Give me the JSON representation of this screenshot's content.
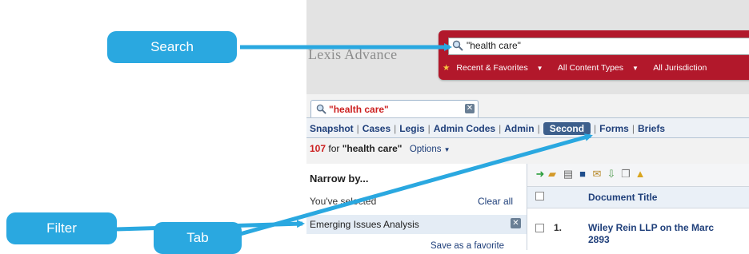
{
  "app": {
    "logo_text": "Lexis Advance",
    "logo_mark": "™"
  },
  "search": {
    "query_value": "\"health care\"",
    "filters": {
      "recent_favorites": "Recent & Favorites",
      "content_types": "All Content Types",
      "jurisdictions": "All Jurisdiction"
    }
  },
  "query_tab": {
    "label": "\"health care\"",
    "close": "✕"
  },
  "content_tabs": [
    {
      "label": "Snapshot"
    },
    {
      "label": "Cases"
    },
    {
      "label": "Legis"
    },
    {
      "label": "Admin Codes"
    },
    {
      "label": "Admin"
    },
    {
      "label": "Second",
      "active": true
    },
    {
      "label": "Forms"
    },
    {
      "label": "Briefs"
    }
  ],
  "results": {
    "count": "107",
    "for_text": "for",
    "query": "\"health care\"",
    "options": "Options"
  },
  "left_panel": {
    "narrow_by": "Narrow by...",
    "selected": "You've selected",
    "clear_all": "Clear all",
    "filter_label": "Emerging Issues Analysis",
    "filter_remove": "✕",
    "save_favorite": "Save as a favorite"
  },
  "right_panel": {
    "column_header": "Document Title",
    "rows": [
      {
        "num": "1.",
        "title": "Wiley Rein LLP on the Marc",
        "title2": "2893"
      }
    ]
  },
  "callouts": {
    "search": "Search",
    "tab": "Tab",
    "filter": "Filter"
  },
  "colors": {
    "callout": "#2aa8e0",
    "search_bar": "#b2182b",
    "query_red": "#cc1f1f",
    "link_blue": "#1f3f7a",
    "active_tab": "#3d5f8c"
  }
}
